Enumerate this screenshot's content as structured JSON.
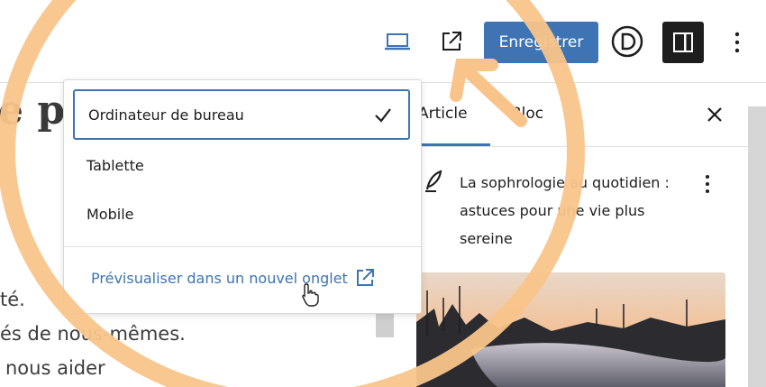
{
  "toolbar": {
    "save_label": "Enregistrer",
    "icons": [
      "laptop-icon",
      "external-link-icon",
      "divi-logo-icon",
      "sidebar-toggle-icon",
      "more-vertical-icon"
    ]
  },
  "canvas": {
    "title_fragment": "e p",
    "lines": [
      "té.",
      "és de nous-mêmes.",
      "nous aider"
    ]
  },
  "preview_menu": {
    "items": [
      {
        "label": "Ordinateur de bureau",
        "selected": true
      },
      {
        "label": "Tablette",
        "selected": false
      },
      {
        "label": "Mobile",
        "selected": false
      }
    ],
    "new_tab_link": "Prévisualiser dans un nouvel onglet"
  },
  "sidebar": {
    "tabs": [
      "Article",
      "Bloc"
    ],
    "active_tab": "Article",
    "post_title": "La sophrologie au quotidien : astuces pour une vie plus sereine"
  },
  "colors": {
    "accent": "#3e74b3",
    "annotation": "#f9c48a",
    "dark": "#1e1e1e"
  }
}
